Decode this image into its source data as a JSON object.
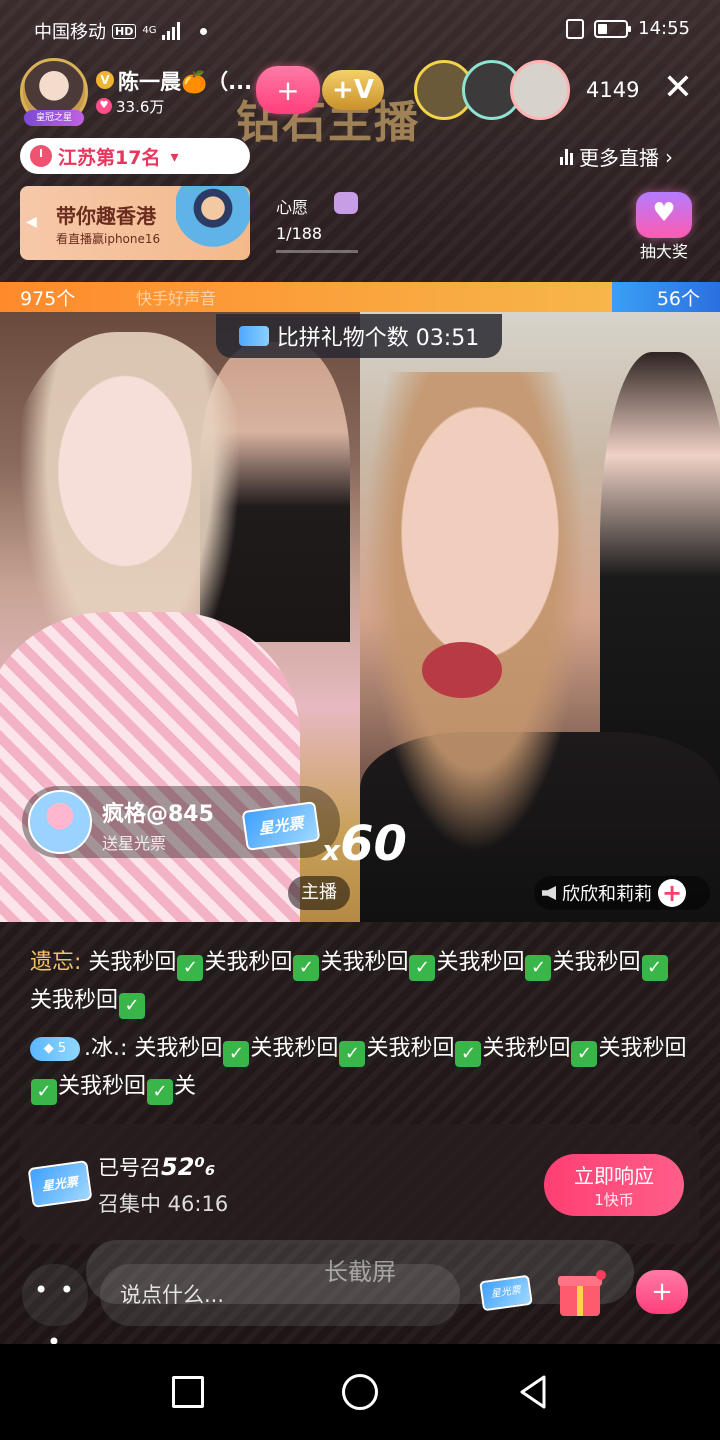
{
  "status_bar": {
    "carrier": "中国移动",
    "hd": "HD",
    "network": "4G",
    "time": "14:55"
  },
  "host": {
    "name": "陈一晨🍊（...",
    "fans": "33.6万",
    "avatar_badge": "皇冠之星",
    "viewer_count": "4149",
    "banner_text": "钻石主播"
  },
  "rank": {
    "label": "江苏第17名"
  },
  "more_live": {
    "label": "更多直播"
  },
  "promo": {
    "title": "带你趣香港",
    "subtitle": "看直播赢iphone16"
  },
  "wish": {
    "label": "心愿",
    "progress": "1/188"
  },
  "lottery": {
    "label": "抽大奖"
  },
  "pk": {
    "left_count": "975个",
    "right_count": "56个",
    "ghost_text": "快手好声音",
    "timer_label": "比拼礼物个数 03:51",
    "left_share": 0.85,
    "colors": {
      "left": "#ff8a2c",
      "right": "#2c6fe0"
    }
  },
  "gift_notice": {
    "user": "疯格@845",
    "action": "送星光票",
    "ticket_label": "星光票",
    "multiplier_prefix": "x",
    "multiplier_value": "60"
  },
  "anchors": {
    "host_tag": "主播",
    "opponent_name": "欣欣和莉莉"
  },
  "chat": [
    {
      "user": "遗忘:",
      "text_parts": [
        "关我秒回",
        "关我秒回",
        "关我秒回",
        "关我秒回",
        "关我秒回",
        "关我秒回"
      ]
    },
    {
      "badge": "5",
      "user": ".冰.:",
      "text_parts": [
        "关我秒回",
        "关我秒回",
        "关我秒回",
        "关我秒回",
        "关我秒回",
        "关我秒回",
        "关"
      ]
    }
  ],
  "rally": {
    "called_prefix": "已号召",
    "called_value": "52⁰₆",
    "timer": "召集中 46:16",
    "ticket_label": "星光票",
    "button_label": "立即响应",
    "button_sub": "1快币"
  },
  "bottom": {
    "more": "• • •",
    "input_placeholder": "说点什么...",
    "screenshot_overlay": "长截屏",
    "ticket_label": "星光票"
  }
}
